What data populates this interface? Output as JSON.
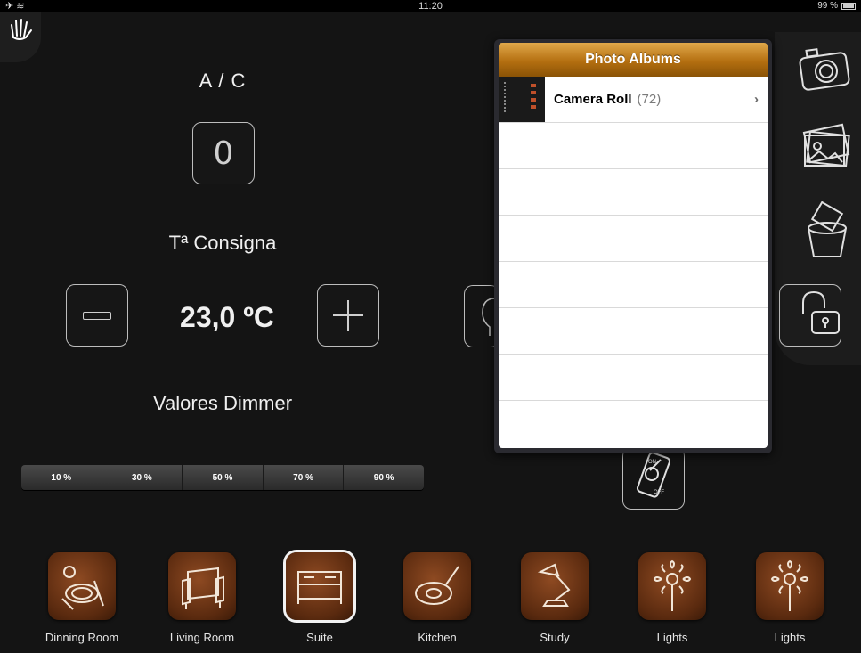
{
  "status_bar": {
    "time": "11:20",
    "battery": "99 %"
  },
  "ac": {
    "title": "A / C",
    "value": "0"
  },
  "setpoint": {
    "title": "Tª Consigna",
    "value": "23,0 ºC"
  },
  "dimmer": {
    "title": "Valores Dimmer",
    "levels": [
      "10 %",
      "30 %",
      "50 %",
      "70 %",
      "90 %"
    ]
  },
  "popover": {
    "title": "Photo Albums",
    "album": {
      "name": "Camera Roll",
      "count": "(72)"
    }
  },
  "side_panel": {
    "icons": [
      "camera-icon",
      "photos-icon",
      "photo-bin-icon"
    ]
  },
  "rooms": [
    {
      "label": "Dinning Room",
      "icon": "dinner-plate-icon"
    },
    {
      "label": "Living Room",
      "icon": "armchair-icon"
    },
    {
      "label": "Suite",
      "icon": "bed-icon",
      "selected": true
    },
    {
      "label": "Kitchen",
      "icon": "frying-pan-icon"
    },
    {
      "label": "Study",
      "icon": "desk-lamp-icon"
    },
    {
      "label": "Lights",
      "icon": "flower-icon"
    },
    {
      "label": "Lights",
      "icon": "flower-icon"
    }
  ]
}
